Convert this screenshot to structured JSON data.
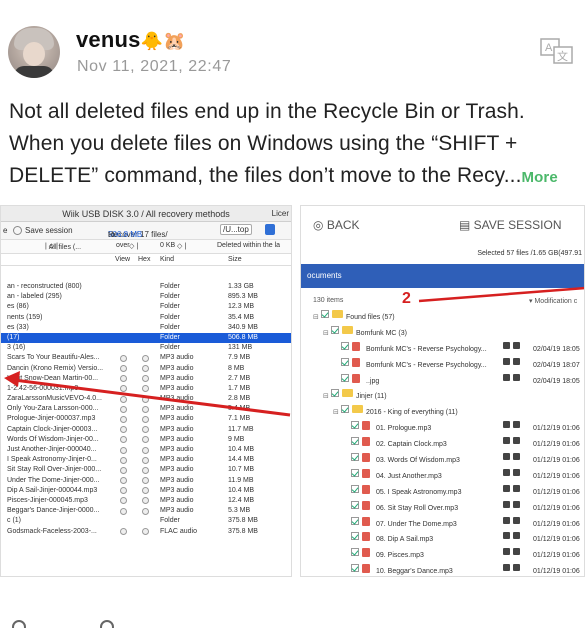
{
  "user": {
    "name": "venus",
    "emoji": "🐥🐹",
    "date": "Nov 11, 2021, 22:47"
  },
  "post": {
    "lines": [
      "Not all deleted files end up in the Recycle Bin or Trash.",
      "When you delete files on Windows using the “SHIFT +",
      "DELETE” command, the files don’t move to the Recy..."
    ],
    "more": "More"
  },
  "left_shot": {
    "title": "Wiik USB DISK 3.0 / All recovery methods",
    "title_right": "Licer",
    "save_session": "Save session",
    "recover_prefix": "Recover 17 files/",
    "recover_size": "506.8 MB",
    "recover_to": "to:",
    "dest": "/U...top",
    "filter_all": "All files (...",
    "filter_over": "over",
    "filter_size": "0 KB",
    "filter_deleted": "Deleted within the la",
    "col_view": "View",
    "col_hex": "Hex",
    "col_kind": "Kind",
    "col_size": "Size",
    "rows": [
      {
        "name": "an - reconstructed (800)",
        "kind": "Folder",
        "size": "1.33 GB",
        "hl": false,
        "icons": false
      },
      {
        "name": "an - labeled (295)",
        "kind": "Folder",
        "size": "895.3 MB",
        "hl": false,
        "icons": false
      },
      {
        "name": "es (86)",
        "kind": "Folder",
        "size": "12.3 MB",
        "hl": false,
        "icons": false
      },
      {
        "name": "nents (159)",
        "kind": "Folder",
        "size": "35.4 MB",
        "hl": false,
        "icons": false
      },
      {
        "name": "es (33)",
        "kind": "Folder",
        "size": "340.9 MB",
        "hl": false,
        "icons": false
      },
      {
        "name": "(17)",
        "kind": "Folder",
        "size": "506.8 MB",
        "hl": true,
        "icons": false
      },
      {
        "name": "3 (16)",
        "kind": "Folder",
        "size": "131 MB",
        "hl": false,
        "icons": false
      },
      {
        "name": "Scars To Your Beautifu-Ales...",
        "kind": "MP3 audio",
        "size": "7.9 MB",
        "hl": false,
        "icons": true
      },
      {
        "name": "Dancin (Krono Remix) Versio...",
        "kind": "MP3 audio",
        "size": "8 MB",
        "hl": false,
        "icons": true
      },
      {
        "name": "Let it Snow-Dean Martin-00...",
        "kind": "MP3 audio",
        "size": "2.7 MB",
        "hl": false,
        "icons": true
      },
      {
        "name": "1-2.42-56-000031.mp3",
        "kind": "MP3 audio",
        "size": "1.7 MB",
        "hl": false,
        "icons": true
      },
      {
        "name": "ZaraLarssonMusicVEVO-4.0...",
        "kind": "MP3 audio",
        "size": "2.8 MB",
        "hl": false,
        "icons": true
      },
      {
        "name": "Only You-Zara Larsson-000...",
        "kind": "MP3 audio",
        "size": "5.4 MB",
        "hl": false,
        "icons": true
      },
      {
        "name": "Prologue-Jinjer-000037.mp3",
        "kind": "MP3 audio",
        "size": "7.1 MB",
        "hl": false,
        "icons": true
      },
      {
        "name": "Captain Clock-Jinjer-00003...",
        "kind": "MP3 audio",
        "size": "11.7 MB",
        "hl": false,
        "icons": true
      },
      {
        "name": "Words Of Wisdom-Jinjer-00...",
        "kind": "MP3 audio",
        "size": "9 MB",
        "hl": false,
        "icons": true
      },
      {
        "name": "Just Another-Jinjer-000040...",
        "kind": "MP3 audio",
        "size": "10.4 MB",
        "hl": false,
        "icons": true
      },
      {
        "name": "I Speak Astronomy-Jinjer-0...",
        "kind": "MP3 audio",
        "size": "14.4 MB",
        "hl": false,
        "icons": true
      },
      {
        "name": "Sit Stay Roll Over-Jinjer-000...",
        "kind": "MP3 audio",
        "size": "10.7 MB",
        "hl": false,
        "icons": true
      },
      {
        "name": "Under The Dome-Jinjer-000...",
        "kind": "MP3 audio",
        "size": "11.9 MB",
        "hl": false,
        "icons": true
      },
      {
        "name": "Dip A Sail-Jinjer-000044.mp3",
        "kind": "MP3 audio",
        "size": "10.4 MB",
        "hl": false,
        "icons": true
      },
      {
        "name": "Pisces-Jinjer-000045.mp3",
        "kind": "MP3 audio",
        "size": "12.4 MB",
        "hl": false,
        "icons": true
      },
      {
        "name": "Beggar's Dance-Jinjer-0000...",
        "kind": "MP3 audio",
        "size": "5.3 MB",
        "hl": false,
        "icons": true
      },
      {
        "name": "c (1)",
        "kind": "Folder",
        "size": "375.8 MB",
        "hl": false,
        "icons": false
      },
      {
        "name": "Godsmack-Faceless-2003-...",
        "kind": "FLAC audio",
        "size": "375.8 MB",
        "hl": false,
        "icons": true
      }
    ]
  },
  "right_shot": {
    "back": "BACK",
    "save_session": "SAVE SESSION",
    "selected_info": "Selected 57 files /1.65 GB(497.91",
    "bluebar": "ocuments",
    "count": "130 items",
    "modcol": "Modification c",
    "annotation": "2",
    "rows": [
      {
        "indent": 0,
        "type": "folder",
        "name": "Found files (57)",
        "date": ""
      },
      {
        "indent": 1,
        "type": "folder",
        "name": "Bomfunk MC (3)",
        "date": ""
      },
      {
        "indent": 2,
        "type": "file",
        "name": "Bomfunk MC's - Reverse Psychology...",
        "date": "02/04/19 18:05"
      },
      {
        "indent": 2,
        "type": "file",
        "name": "Bomfunk MC's - Reverse Psychology...",
        "date": "02/04/19 18:07"
      },
      {
        "indent": 2,
        "type": "img",
        "name": "..jpg",
        "date": "02/04/19 18:05"
      },
      {
        "indent": 1,
        "type": "folder",
        "name": "Jinjer (11)",
        "date": ""
      },
      {
        "indent": 2,
        "type": "folder",
        "name": "2016 - King of everything (11)",
        "date": ""
      },
      {
        "indent": 3,
        "type": "file",
        "name": "01. Prologue.mp3",
        "date": "01/12/19 01:06"
      },
      {
        "indent": 3,
        "type": "file",
        "name": "02. Captain Clock.mp3",
        "date": "01/12/19 01:06"
      },
      {
        "indent": 3,
        "type": "file",
        "name": "03. Words Of Wisdom.mp3",
        "date": "01/12/19 01:06"
      },
      {
        "indent": 3,
        "type": "file",
        "name": "04. Just Another.mp3",
        "date": "01/12/19 01:06"
      },
      {
        "indent": 3,
        "type": "file",
        "name": "05. I Speak Astronomy.mp3",
        "date": "01/12/19 01:06"
      },
      {
        "indent": 3,
        "type": "file",
        "name": "06. Sit Stay Roll Over.mp3",
        "date": "01/12/19 01:06"
      },
      {
        "indent": 3,
        "type": "file",
        "name": "07. Under The Dome.mp3",
        "date": "01/12/19 01:06"
      },
      {
        "indent": 3,
        "type": "file",
        "name": "08. Dip A Sail.mp3",
        "date": "01/12/19 01:06"
      },
      {
        "indent": 3,
        "type": "file",
        "name": "09. Pisces.mp3",
        "date": "01/12/19 01:06"
      },
      {
        "indent": 3,
        "type": "file",
        "name": "10. Beggar's Dance.mp3",
        "date": "01/12/19 01:06"
      }
    ]
  },
  "icons": [
    "translate-icon",
    "info-icon",
    "check-icon",
    "folder-icon",
    "audio-file-icon"
  ],
  "colors": {
    "accent": "#4bb86a",
    "selection": "#1a5bd8",
    "bluebar": "#2f5fb8",
    "annotation": "#d62020"
  }
}
